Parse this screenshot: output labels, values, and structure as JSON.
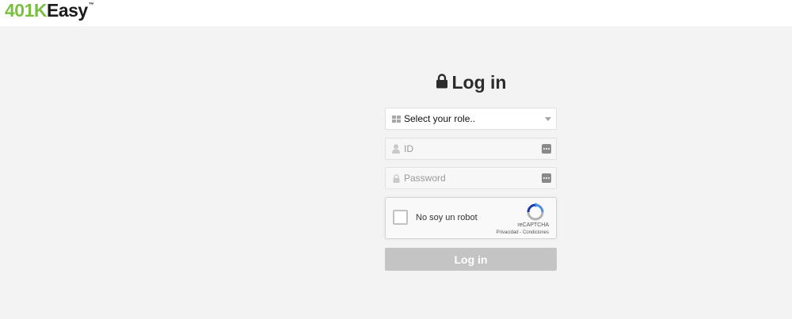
{
  "logo": {
    "part1": "401K",
    "part2": "Easy",
    "tm": "™"
  },
  "login": {
    "title": "Log in",
    "role_select": {
      "selected": "Select your role.."
    },
    "id_field": {
      "value": "",
      "placeholder": "ID"
    },
    "password_field": {
      "value": "",
      "placeholder": "Password"
    },
    "captcha": {
      "label": "No soy un robot",
      "brand": "reCAPTCHA",
      "links": "Privacidad - Condiciones"
    },
    "submit_label": "Log in"
  },
  "colors": {
    "logo_green": "#7bc043",
    "background": "#f3f3f3",
    "button_disabled": "#c4c4c4"
  },
  "icons": [
    "lock-icon",
    "grid-icon",
    "user-icon",
    "small-lock-icon",
    "dots-icon",
    "recaptcha-icon",
    "dropdown-caret-icon"
  ]
}
